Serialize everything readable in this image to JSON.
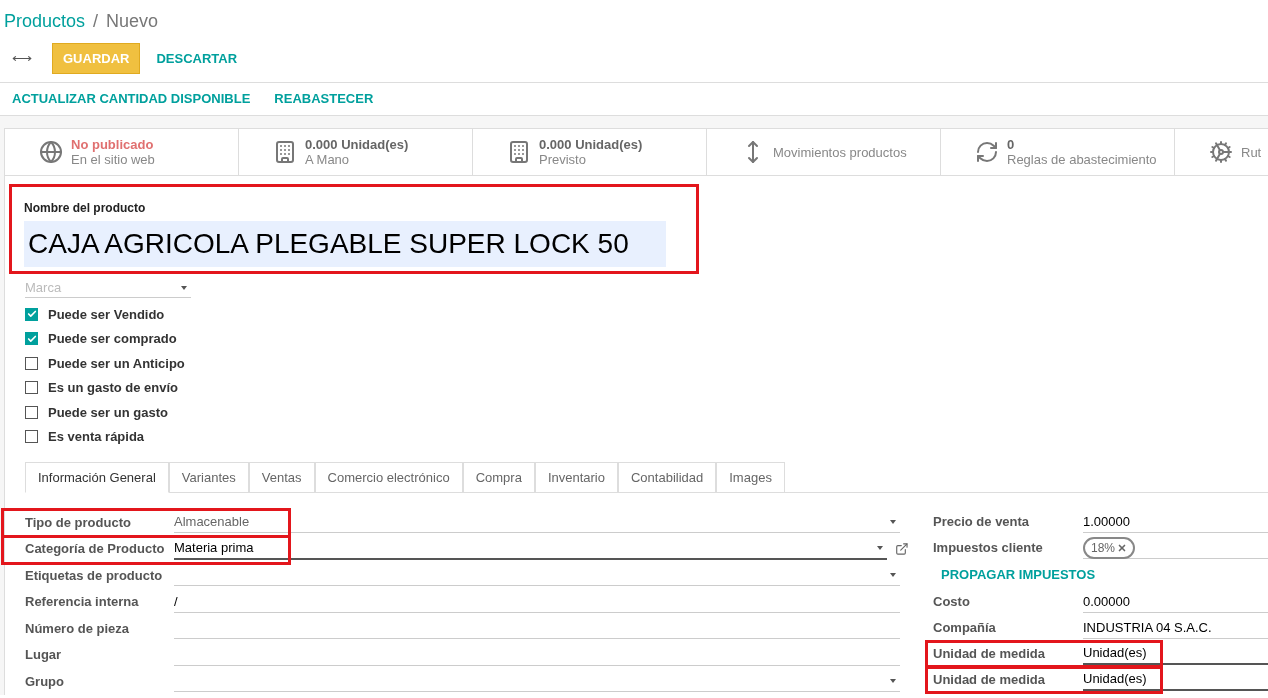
{
  "breadcrumb": {
    "parent": "Productos",
    "separator": "/",
    "current": "Nuevo"
  },
  "toolbar": {
    "toggle_icon": "⟷",
    "buttons": [
      {
        "label": "GUARDAR",
        "kind": "primary"
      },
      {
        "label": "DESCARTAR",
        "kind": "link"
      }
    ]
  },
  "action_bar": [
    "ACTUALIZAR CANTIDAD DISPONIBLE",
    "REABASTECER"
  ],
  "stat_buttons": [
    {
      "kind": "website",
      "value": "No publicado",
      "label": "En el sitio web",
      "warning": true
    },
    {
      "kind": "onhand",
      "value": "0.000 Unidad(es)",
      "label": "A Mano",
      "warning": false
    },
    {
      "kind": "forecast",
      "value": "0.000 Unidad(es)",
      "label": "Previsto",
      "warning": false
    },
    {
      "kind": "moves",
      "label": "Movimientos productos",
      "warning": false
    },
    {
      "kind": "rules",
      "value": "0",
      "label": "Reglas de abastecimiento",
      "warning": false
    },
    {
      "kind": "routes",
      "label": "Rut",
      "warning": false
    }
  ],
  "product_name": {
    "label": "Nombre del producto",
    "value": "CAJA AGRICOLA PLEGABLE SUPER LOCK 50",
    "highlighted": true
  },
  "brand": {
    "placeholder": "Marca"
  },
  "checkboxes": [
    {
      "label": "Puede ser Vendido",
      "checked": true
    },
    {
      "label": "Puede ser comprado",
      "checked": true
    },
    {
      "label": "Puede ser un Anticipo",
      "checked": false
    },
    {
      "label": "Es un gasto de envío",
      "checked": false
    },
    {
      "label": "Puede ser un gasto",
      "checked": false
    },
    {
      "label": "Es venta rápida",
      "checked": false
    }
  ],
  "tabs": [
    {
      "label": "Información General",
      "selected": true
    },
    {
      "label": "Variantes",
      "selected": false
    },
    {
      "label": "Ventas",
      "selected": false
    },
    {
      "label": "Comercio electrónico",
      "selected": false
    },
    {
      "label": "Compra",
      "selected": false
    },
    {
      "label": "Inventario",
      "selected": false
    },
    {
      "label": "Contabilidad",
      "selected": false
    },
    {
      "label": "Images",
      "selected": false
    }
  ],
  "left_fields": [
    {
      "label": "Tipo de producto",
      "value": "Almacenable",
      "kind": "select",
      "highlighted": true,
      "focused": false
    },
    {
      "label": "Categoría de Producto",
      "value": "Materia prima",
      "kind": "select",
      "highlighted": true,
      "focused": true,
      "external_link": true
    },
    {
      "label": "Etiquetas de producto",
      "kind": "select",
      "highlighted": false,
      "focused": false
    },
    {
      "label": "Referencia interna",
      "value": "/",
      "kind": "text",
      "highlighted": false,
      "focused": false
    },
    {
      "label": "Número de pieza",
      "kind": "text",
      "highlighted": false,
      "focused": false
    },
    {
      "label": "Lugar",
      "kind": "text",
      "highlighted": false,
      "focused": false
    },
    {
      "label": "Grupo",
      "kind": "select",
      "highlighted": false,
      "focused": false
    }
  ],
  "right_fields": [
    {
      "label": "Precio de venta",
      "value": "1.00000",
      "kind": "text",
      "highlighted": false
    },
    {
      "label": "Impuestos cliente",
      "tags": [
        "18%"
      ],
      "kind": "tags",
      "highlighted": false
    },
    {
      "label": "PROPAGAR IMPUESTOS",
      "kind": "button",
      "highlighted": false
    },
    {
      "label": "Costo",
      "value": "0.00000",
      "kind": "text",
      "highlighted": false
    },
    {
      "label": "Compañía",
      "value": "INDUSTRIA 04 S.A.C.",
      "kind": "text",
      "highlighted": false
    },
    {
      "label": "Unidad de medida",
      "value": "Unidad(es)",
      "kind": "select",
      "highlighted": true
    },
    {
      "label": "Unidad de medida",
      "value": "Unidad(es)",
      "kind": "select",
      "highlighted": true
    }
  ]
}
